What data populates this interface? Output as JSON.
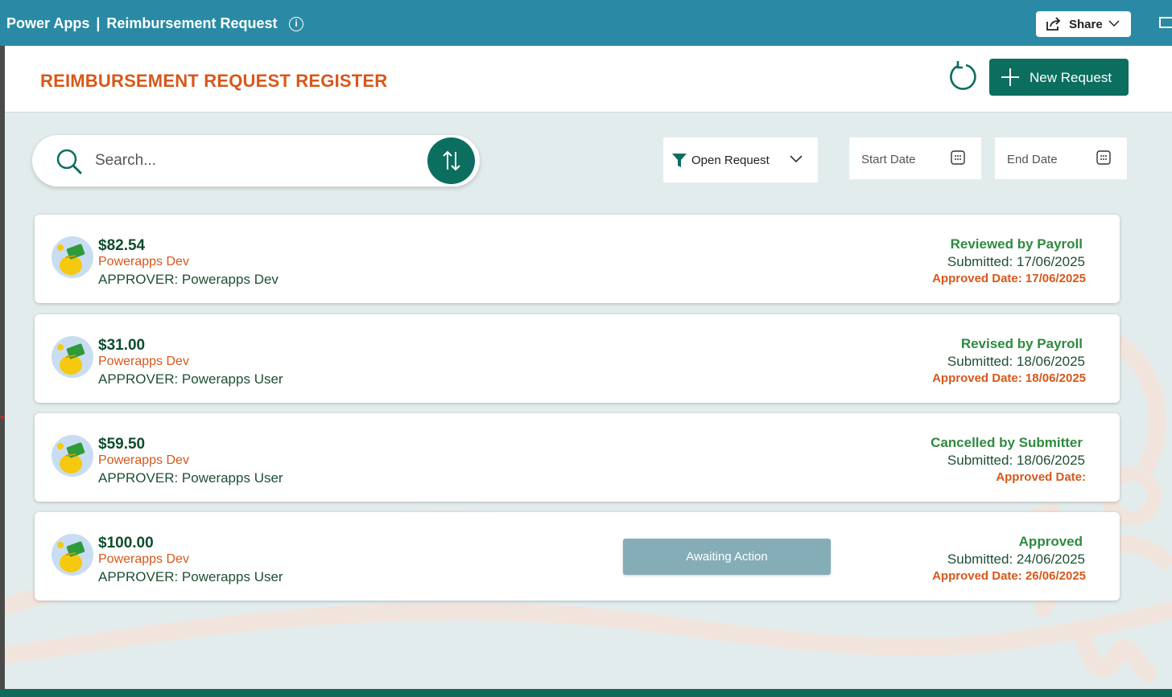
{
  "topbar": {
    "app_name": "Power Apps",
    "separator": "|",
    "app_title": "Reimbursement Request",
    "share_label": "Share"
  },
  "header": {
    "title": "REIMBURSEMENT REQUEST REGISTER",
    "new_request_label": "New Request"
  },
  "search": {
    "placeholder": "Search..."
  },
  "filter": {
    "selected": "Open Request"
  },
  "date_filters": {
    "start_placeholder": "Start Date",
    "end_placeholder": "End Date"
  },
  "requests": [
    {
      "amount": "$82.54",
      "submitter": "Powerapps Dev",
      "approver": "APPROVER: Powerapps Dev",
      "status": "Reviewed by Payroll",
      "submitted": "Submitted: 17/06/2025",
      "approved": "Approved Date: 17/06/2025"
    },
    {
      "amount": "$31.00",
      "submitter": "Powerapps Dev",
      "approver": "APPROVER: Powerapps User",
      "status": "Revised by Payroll",
      "submitted": "Submitted: 18/06/2025",
      "approved": "Approved Date: 18/06/2025"
    },
    {
      "amount": "$59.50",
      "submitter": "Powerapps Dev",
      "approver": "APPROVER: Powerapps User",
      "status": "Cancelled by Submitter",
      "submitted": "Submitted: 18/06/2025",
      "approved": "Approved Date:"
    },
    {
      "amount": "$100.00",
      "submitter": "Powerapps Dev",
      "approver": "APPROVER: Powerapps User",
      "status": "Approved",
      "submitted": "Submitted: 24/06/2025",
      "approved": "Approved Date: 26/06/2025",
      "action_label": "Awaiting Action"
    }
  ],
  "icons": {
    "info": "info-icon",
    "share": "share-icon",
    "refresh": "refresh-icon",
    "add": "plus-icon",
    "search": "search-icon",
    "sort": "sort-icon",
    "filter": "funnel-icon",
    "calendar": "calendar-icon",
    "avatar": "money-bag-icon"
  },
  "colors": {
    "topbar": "#2a8aa5",
    "primary": "#0b6e5e",
    "title_orange": "#d8571a",
    "status_green": "#2e8a3e",
    "amount_green": "#0e4d2e",
    "canvas_bg": "#e3ecec",
    "awaiting_button": "#85adb8"
  }
}
